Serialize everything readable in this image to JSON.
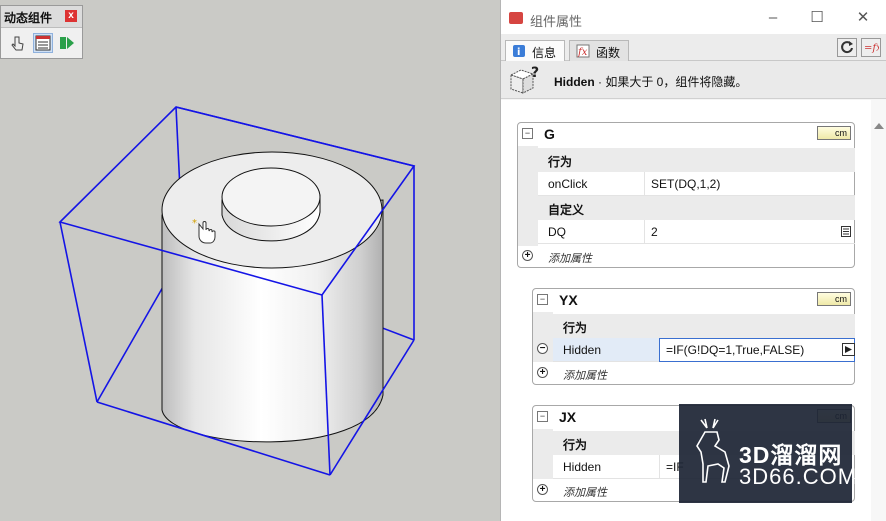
{
  "toolbar": {
    "title": "动态组件",
    "close": "x"
  },
  "panel": {
    "title": "组件属性",
    "tabs": [
      {
        "label": "信息",
        "active": true
      },
      {
        "label": "函数",
        "active": false
      }
    ],
    "info": {
      "bold": "Hidden",
      "text": " · 如果大于 0，组件将隐藏。"
    },
    "components": [
      {
        "name": "G",
        "unit": "cm",
        "sections": [
          {
            "title": "行为",
            "rows": [
              {
                "label": "onClick",
                "value": "SET(DQ,1,2)"
              }
            ]
          },
          {
            "title": "自定义",
            "rows": [
              {
                "label": "DQ",
                "value": "2"
              }
            ]
          }
        ],
        "add_label": "添加属性"
      },
      {
        "name": "YX",
        "unit": "cm",
        "sections": [
          {
            "title": "行为",
            "rows": [
              {
                "label": "Hidden",
                "value": "=IF(G!DQ=1,True,FALSE)"
              }
            ]
          }
        ],
        "add_label": "添加属性"
      },
      {
        "name": "JX",
        "unit": "cm",
        "sections": [
          {
            "title": "行为",
            "rows": [
              {
                "label": "Hidden",
                "value": "=IF"
              }
            ]
          }
        ],
        "add_label": "添加属性"
      }
    ]
  },
  "watermark": {
    "brand": "3D溜溜网",
    "url": "3D66.COM"
  },
  "colors": {
    "selection_box": "#1414e6",
    "accent": "#d64541",
    "watermark_bg": "#1c2434"
  }
}
